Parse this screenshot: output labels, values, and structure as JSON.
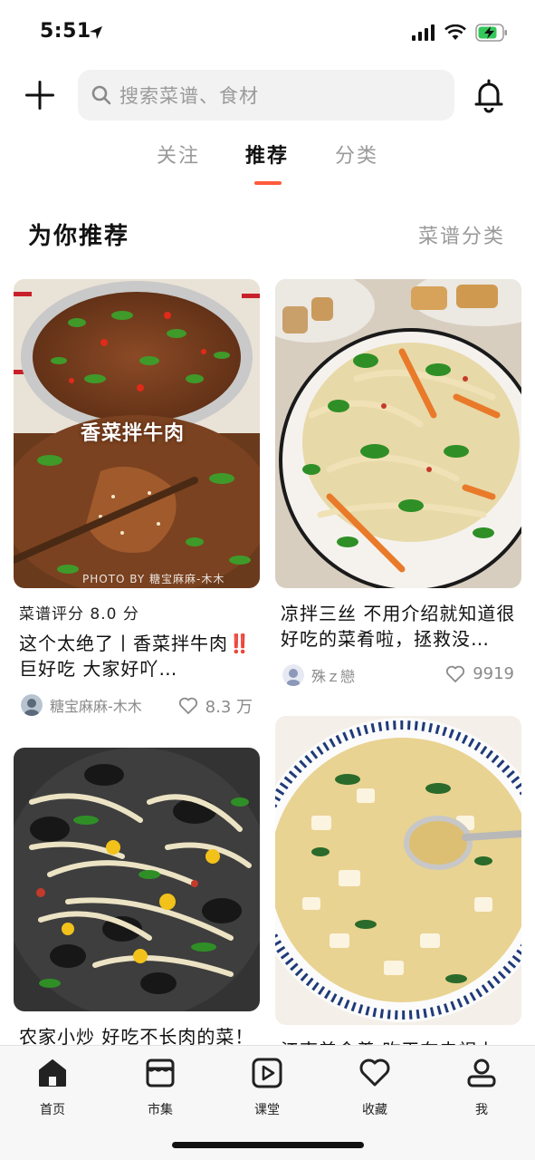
{
  "status_bar": {
    "time": "5:51"
  },
  "header": {
    "search_placeholder": "搜索菜谱、食材"
  },
  "tabs": [
    {
      "label": "关注",
      "active": false
    },
    {
      "label": "推荐",
      "active": true
    },
    {
      "label": "分类",
      "active": false
    }
  ],
  "section": {
    "title": "为你推荐",
    "link": "菜谱分类"
  },
  "cards": [
    {
      "score": "菜谱评分 8.0 分",
      "title": "这个太绝了丨香菜拌牛肉‼️巨好吃 大家好吖…",
      "author": "糖宝麻麻-木木",
      "likes": "8.3 万",
      "image_caption": "香菜拌牛肉",
      "image_watermark": "PHOTO BY 糖宝麻麻-木木"
    },
    {
      "title": "凉拌三丝 不用介绍就知道很好吃的菜肴啦，拯救没…",
      "author": "殊ｚ戀",
      "likes": "9919"
    },
    {
      "title": "农家小炒 好吃不长肉的菜！"
    },
    {
      "title": "江南美食羹 昨天在电视上"
    }
  ],
  "bottom_nav": [
    {
      "label": "首页",
      "icon": "home-icon",
      "active": true
    },
    {
      "label": "市集",
      "icon": "market-icon",
      "active": false
    },
    {
      "label": "课堂",
      "icon": "play-icon",
      "active": false
    },
    {
      "label": "收藏",
      "icon": "heart-icon",
      "active": false
    },
    {
      "label": "我",
      "icon": "user-icon",
      "active": false
    }
  ],
  "colors": {
    "accent": "#ff5a3c",
    "battery": "#34c759",
    "muted": "#9a9a9a"
  }
}
